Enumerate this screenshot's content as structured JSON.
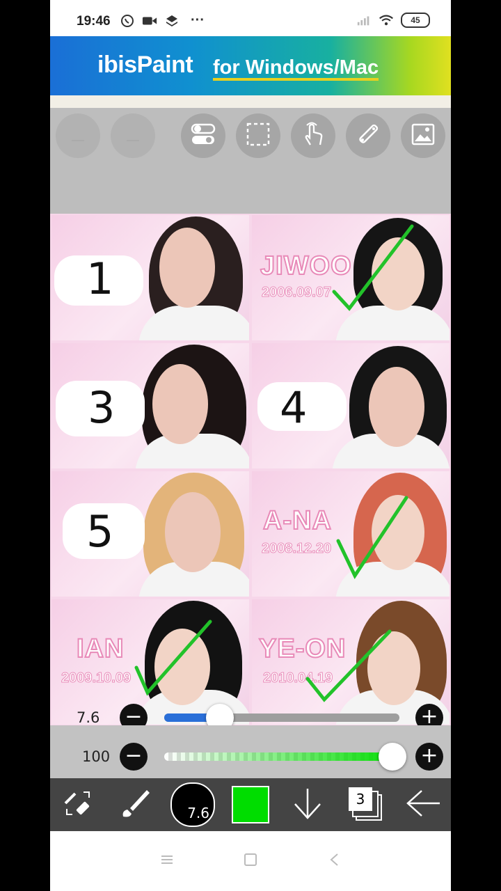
{
  "status_bar": {
    "time": "19:46",
    "battery": "45",
    "more": "···"
  },
  "banner": {
    "logo": "ibisPaint",
    "subtitle": "for Windows/Mac"
  },
  "toolbar": {
    "buttons": [
      "undo",
      "redo",
      "toggle",
      "selection",
      "gesture",
      "ruler",
      "reference-image"
    ]
  },
  "canvas": {
    "cells": [
      {
        "type": "number",
        "label": "1"
      },
      {
        "type": "name",
        "name": "JIWOO",
        "date": "2006.09.07",
        "checked": true
      },
      {
        "type": "number",
        "label": "3"
      },
      {
        "type": "number",
        "label": "4"
      },
      {
        "type": "number",
        "label": "5"
      },
      {
        "type": "name",
        "name": "A-NA",
        "date": "2008.12.20",
        "checked": true
      },
      {
        "type": "name",
        "name": "IAN",
        "date": "2009.10.09",
        "checked": true
      },
      {
        "type": "name",
        "name": "YE-ON",
        "date": "2010.04.19",
        "checked": true
      }
    ]
  },
  "brush_size": {
    "value": "7.6",
    "minus": "−",
    "plus": "+",
    "level_fraction": 0.2
  },
  "opacity": {
    "value": "100",
    "minus": "−",
    "plus": "+",
    "level_fraction": 1.0
  },
  "bottom_bar": {
    "brush_size_display": "7.6",
    "layer_count": "3",
    "current_color": "#00dd00"
  },
  "colors": {
    "check_green": "#22c22a",
    "label_pink": "#e88ab8",
    "toolbar_gray": "#bdbdbd"
  }
}
